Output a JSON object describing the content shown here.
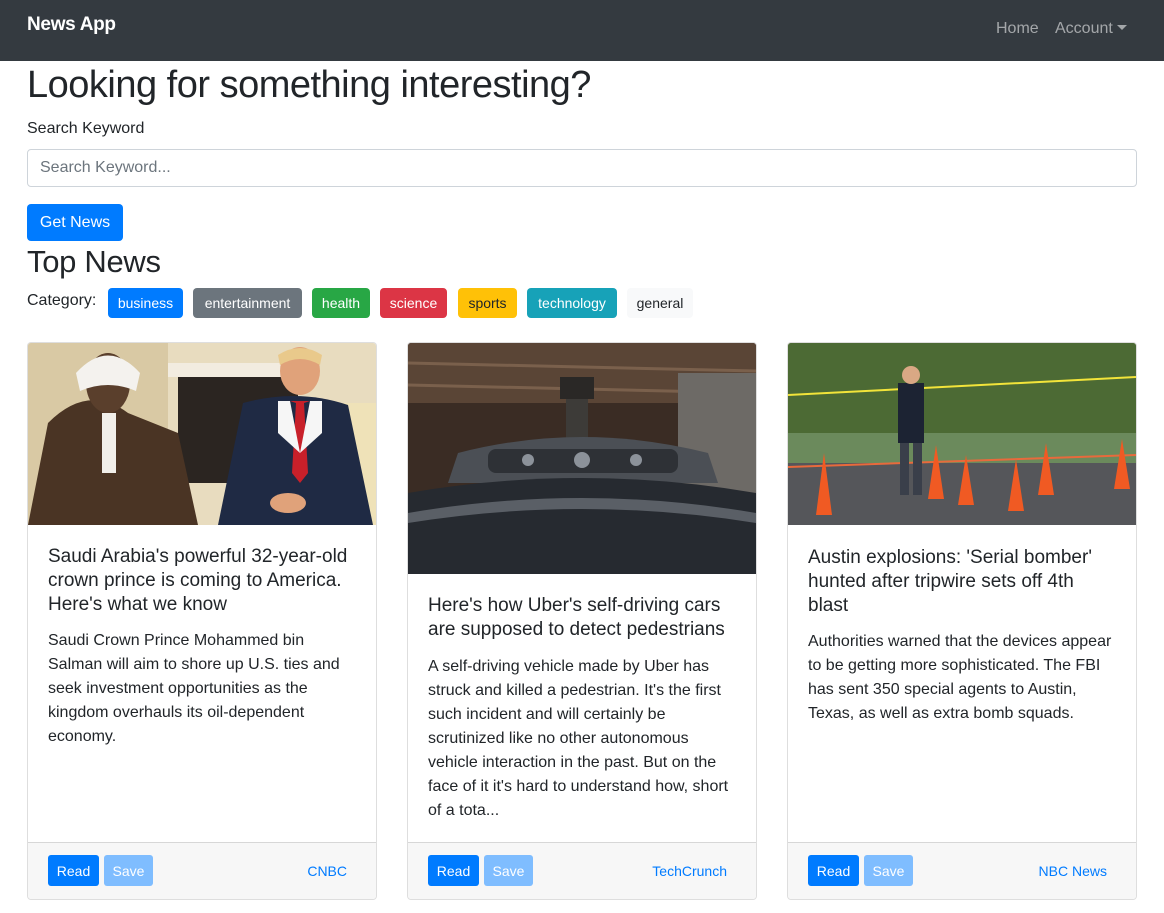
{
  "navbar": {
    "brand": "News App",
    "links": [
      {
        "label": "Home"
      },
      {
        "label": "Account"
      }
    ]
  },
  "search": {
    "heading": "Looking for something interesting?",
    "label": "Search Keyword",
    "placeholder": "Search Keyword...",
    "value": "",
    "button_label": "Get News"
  },
  "top_news": {
    "title": "Top News",
    "category_label": "Category:",
    "categories": [
      {
        "label": "business",
        "color": "#007bff"
      },
      {
        "label": "entertainment",
        "color": "#6c757d"
      },
      {
        "label": "health",
        "color": "#28a745"
      },
      {
        "label": "science",
        "color": "#dc3545"
      },
      {
        "label": "sports",
        "color": "#ffc107"
      },
      {
        "label": "technology",
        "color": "#17a2b8"
      },
      {
        "label": "general",
        "color": "#f8f9fa"
      }
    ]
  },
  "articles": [
    {
      "title": "Saudi Arabia's powerful 32-year-old crown prince is coming to America. Here's what we know",
      "description": "Saudi Crown Prince Mohammed bin Salman will aim to shore up U.S. ties and seek investment opportunities as the kingdom overhauls its oil-dependent economy.",
      "source": "CNBC",
      "read_label": "Read",
      "save_label": "Save"
    },
    {
      "title": "Here's how Uber's self-driving cars are supposed to detect pedestrians",
      "description": "A self-driving vehicle made by Uber has struck and killed a pedestrian. It's the first such incident and will certainly be scrutinized like no other autonomous vehicle interaction in the past. But on the face of it it's hard to understand how, short of a tota...",
      "source": "TechCrunch",
      "read_label": "Read",
      "save_label": "Save"
    },
    {
      "title": "Austin explosions: 'Serial bomber' hunted after tripwire sets off 4th blast",
      "description": "Authorities warned that the devices appear to be getting more sophisticated. The FBI has sent 350 special agents to Austin, Texas, as well as extra bomb squads.",
      "source": "NBC News",
      "read_label": "Read",
      "save_label": "Save"
    }
  ]
}
